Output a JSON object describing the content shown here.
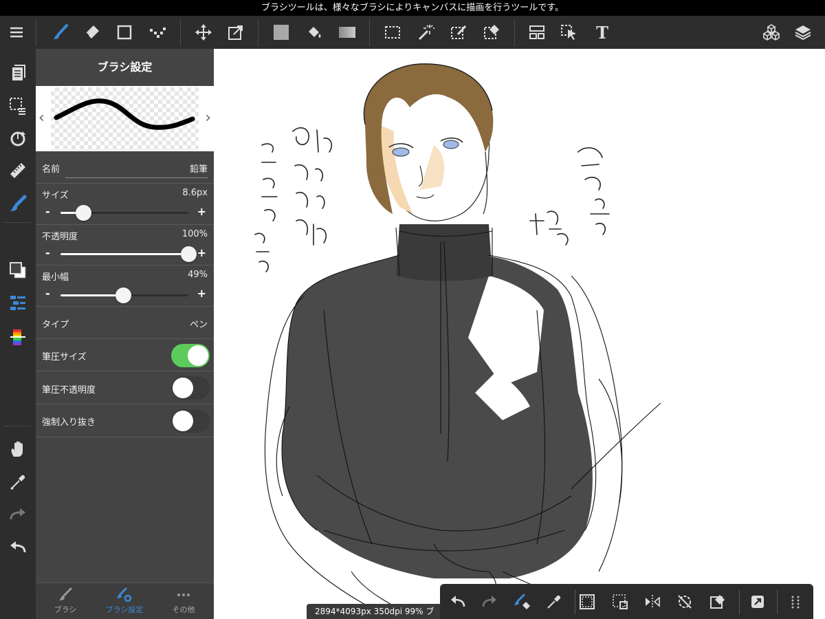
{
  "hint_text": "ブラシツールは、様々なブラシによりキャンバスに描画を行うツールです。",
  "panel": {
    "title": "ブラシ設定",
    "name_label": "名前",
    "name_value": "鉛筆",
    "size_label": "サイズ",
    "size_value": "8.6px",
    "size_level": 0.18,
    "opacity_label": "不透明度",
    "opacity_value": "100%",
    "opacity_level": 1.0,
    "min_width_label": "最小幅",
    "min_width_value": "49%",
    "min_width_level": 0.49,
    "type_label": "タイプ",
    "type_value": "ペン",
    "pressure_size_label": "筆圧サイズ",
    "pressure_size_on": true,
    "pressure_opacity_label": "筆圧不透明度",
    "pressure_opacity_on": false,
    "forced_taper_label": "強制入り抜き",
    "forced_taper_on": false,
    "minus": "-",
    "plus": "+",
    "prev_arrow": "‹",
    "next_arrow": "›"
  },
  "tabs": [
    {
      "label": "ブラシ"
    },
    {
      "label": "ブラシ設定"
    },
    {
      "label": "その他"
    }
  ],
  "status_text": "2894*4093px 350dpi 99% ブ",
  "accent_color": "#3b8ad8",
  "toggle_on_color": "#5ccb5c",
  "toolbar_text_tool": "T",
  "icons": {
    "toolbar": [
      "menu-icon",
      "brush-icon",
      "eraser-icon",
      "rectangle-icon",
      "dot-tool-icon",
      "move-icon",
      "transform-icon",
      "fill-color-icon",
      "bucket-icon",
      "gradient-icon",
      "select-rect-icon",
      "magic-wand-icon",
      "select-pen-icon",
      "select-eraser-icon",
      "layer-move-icon",
      "object-select-icon",
      "text-icon",
      "3d-cube-icon",
      "layers-icon"
    ],
    "rail": [
      "page-icon",
      "selection-icon",
      "rotate-icon",
      "ruler-icon",
      "brush-active-icon",
      "color-swatch-icon",
      "layer-list-icon",
      "color-picker-icon",
      "hand-icon",
      "eyedropper-icon",
      "redo-icon",
      "undo-icon"
    ],
    "quick": [
      "undo-icon",
      "redo-icon",
      "brush-eraser-icon",
      "eyedropper-icon",
      "select-all-icon",
      "transform-select-icon",
      "flip-icon",
      "rotate-reset-icon",
      "fill-select-icon",
      "export-icon",
      "grid-dots-icon"
    ]
  }
}
